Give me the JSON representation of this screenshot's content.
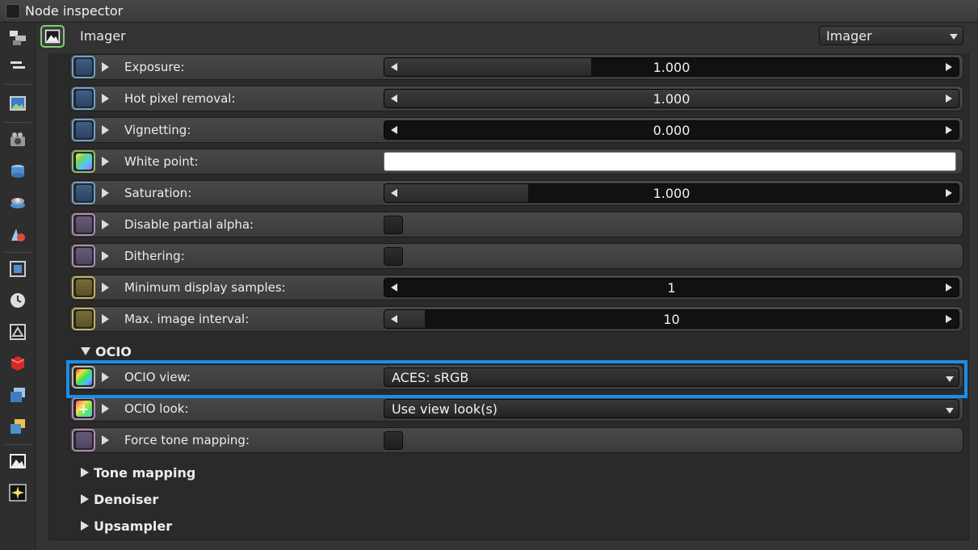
{
  "window": {
    "title": "Node inspector"
  },
  "node": {
    "name": "Imager",
    "type_select": "Imager"
  },
  "toolbar": {
    "tools": [
      "node-graph-icon",
      "layers-icon",
      "image-icon",
      "camera-icon",
      "geometry-icon",
      "object-layer-icon",
      "material-icon",
      "render-region-icon",
      "clock-icon",
      "texture-icon",
      "cube-red-icon",
      "instances-icon",
      "layer-stack-icon",
      "imager-icon",
      "postprocess-icon"
    ]
  },
  "params": [
    {
      "label": "Exposure:",
      "kind": "slider",
      "icon": "blue",
      "value": "1.000",
      "fill": 0.36
    },
    {
      "label": "Hot pixel removal:",
      "kind": "slider",
      "icon": "blue",
      "value": "1.000",
      "fill": 1.0
    },
    {
      "label": "Vignetting:",
      "kind": "slider",
      "icon": "blue",
      "value": "0.000",
      "fill": 0.0
    },
    {
      "label": "White point:",
      "kind": "color",
      "icon": "green",
      "value": "#ffffff"
    },
    {
      "label": "Saturation:",
      "kind": "slider",
      "icon": "blue",
      "value": "1.000",
      "fill": 0.25
    },
    {
      "label": "Disable partial alpha:",
      "kind": "checkbox",
      "icon": "pink",
      "checked": false
    },
    {
      "label": "Dithering:",
      "kind": "checkbox",
      "icon": "pink",
      "checked": false
    },
    {
      "label": "Minimum display samples:",
      "kind": "slider",
      "icon": "yellow",
      "value": "1",
      "fill": 0.0
    },
    {
      "label": "Max. image interval:",
      "kind": "slider",
      "icon": "yellow",
      "value": "10",
      "fill": 0.07
    }
  ],
  "ocio": {
    "section_label": "OCIO",
    "params": [
      {
        "label": "OCIO view:",
        "kind": "dropdown",
        "icon": "rainbow",
        "value": "ACES: sRGB",
        "highlighted": true
      },
      {
        "label": "OCIO look:",
        "kind": "dropdown",
        "icon": "plus",
        "value": "Use view look(s)"
      },
      {
        "label": "Force tone mapping:",
        "kind": "checkbox",
        "icon": "pink",
        "checked": false
      }
    ]
  },
  "collapsed_sections": [
    "Tone mapping",
    "Denoiser",
    "Upsampler"
  ],
  "colors": {
    "highlight": "#1b8ee8",
    "panel": "#333333",
    "row": "#424242"
  }
}
